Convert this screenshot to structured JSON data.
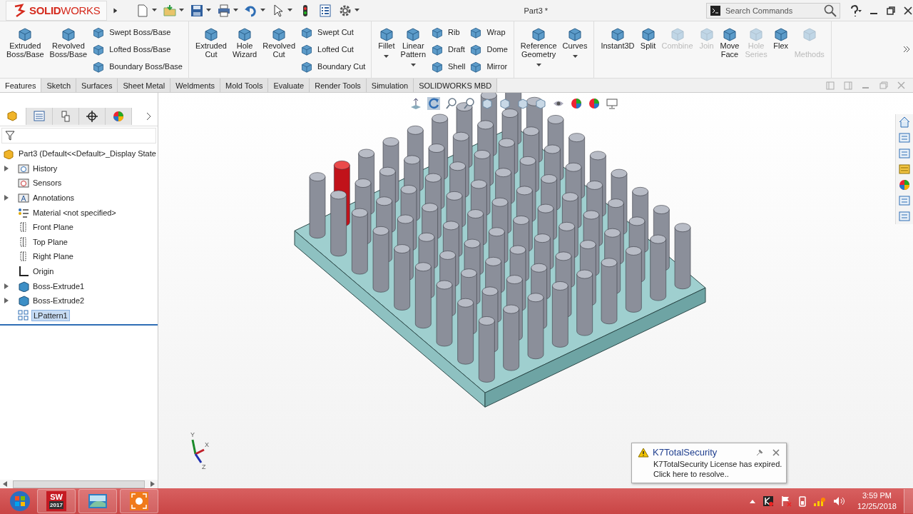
{
  "window": {
    "logo_prefix": "SOLID",
    "logo_suffix": "WORKS",
    "title": "Part3 *"
  },
  "quick_access": [
    {
      "dropdown": true
    },
    {
      "dropdown": true
    },
    {
      "dropdown": true
    },
    {
      "dropdown": true
    },
    {
      "dropdown": true
    },
    {
      "dropdown": true
    },
    {
      "dropdown": false
    },
    {
      "dropdown": false
    },
    {
      "dropdown": true
    }
  ],
  "search": {
    "placeholder": "Search Commands"
  },
  "ribbon": {
    "groups": [
      {
        "items": [
          {
            "kind": "large",
            "label": "Extruded\nBoss/Base",
            "disabled": false,
            "dropdown": false
          },
          {
            "kind": "large",
            "label": "Revolved\nBoss/Base",
            "disabled": false,
            "dropdown": false
          },
          {
            "kind": "stack",
            "items": [
              {
                "label": "Swept Boss/Base"
              },
              {
                "label": "Lofted Boss/Base"
              },
              {
                "label": "Boundary Boss/Base"
              }
            ]
          }
        ]
      },
      {
        "items": [
          {
            "kind": "large",
            "label": "Extruded\nCut",
            "disabled": false,
            "dropdown": false
          },
          {
            "kind": "large",
            "label": "Hole\nWizard",
            "disabled": false,
            "dropdown": false
          },
          {
            "kind": "large",
            "label": "Revolved\nCut",
            "disabled": false,
            "dropdown": false
          },
          {
            "kind": "stack",
            "items": [
              {
                "label": "Swept Cut"
              },
              {
                "label": "Lofted Cut"
              },
              {
                "label": "Boundary Cut"
              }
            ]
          }
        ]
      },
      {
        "items": [
          {
            "kind": "large",
            "label": "Fillet",
            "disabled": false,
            "dropdown": true
          },
          {
            "kind": "large",
            "label": "Linear\nPattern",
            "disabled": false,
            "dropdown": true
          },
          {
            "kind": "stack",
            "items": [
              {
                "label": "Rib"
              },
              {
                "label": "Draft"
              },
              {
                "label": "Shell"
              }
            ]
          },
          {
            "kind": "stack",
            "items": [
              {
                "label": "Wrap"
              },
              {
                "label": "Dome"
              },
              {
                "label": "Mirror"
              }
            ]
          }
        ]
      },
      {
        "items": [
          {
            "kind": "large",
            "label": "Reference\nGeometry",
            "disabled": false,
            "dropdown": true
          },
          {
            "kind": "large",
            "label": "Curves",
            "disabled": false,
            "dropdown": true
          }
        ]
      },
      {
        "items": [
          {
            "kind": "large",
            "label": "Instant3D",
            "disabled": false,
            "dropdown": false
          },
          {
            "kind": "large",
            "label": "Split",
            "disabled": false,
            "dropdown": false
          },
          {
            "kind": "large",
            "label": "Combine",
            "disabled": true,
            "dropdown": false
          },
          {
            "kind": "large",
            "label": "Join",
            "disabled": true,
            "dropdown": false
          },
          {
            "kind": "large",
            "label": "Move\nFace",
            "disabled": false,
            "dropdown": false
          },
          {
            "kind": "large",
            "label": "Hole\nSeries",
            "disabled": true,
            "dropdown": false
          },
          {
            "kind": "large",
            "label": "Flex",
            "disabled": false,
            "dropdown": false
          },
          {
            "kind": "large",
            "label": "\nMethods",
            "disabled": true,
            "dropdown": false
          }
        ]
      }
    ]
  },
  "tabs": [
    {
      "label": "Features",
      "selected": true
    },
    {
      "label": "Sketch",
      "selected": false
    },
    {
      "label": "Surfaces",
      "selected": false
    },
    {
      "label": "Sheet Metal",
      "selected": false
    },
    {
      "label": "Weldments",
      "selected": false
    },
    {
      "label": "Mold Tools",
      "selected": false
    },
    {
      "label": "Evaluate",
      "selected": false
    },
    {
      "label": "Render Tools",
      "selected": false
    },
    {
      "label": "Simulation",
      "selected": false
    },
    {
      "label": "SOLIDWORKS MBD",
      "selected": false
    }
  ],
  "panel_tabs": [
    {
      "selected": true
    },
    {
      "selected": false
    },
    {
      "selected": false
    },
    {
      "selected": false
    },
    {
      "selected": false
    }
  ],
  "tree": {
    "root": "Part3  (Default<<Default>_Display State",
    "items": [
      {
        "kind": "history",
        "label": "History",
        "expandable": true,
        "selected": false
      },
      {
        "kind": "sensors",
        "label": "Sensors",
        "expandable": false,
        "selected": false
      },
      {
        "kind": "annotations",
        "label": "Annotations",
        "expandable": true,
        "selected": false
      },
      {
        "kind": "material",
        "label": "Material <not specified>",
        "expandable": false,
        "selected": false
      },
      {
        "kind": "plane",
        "label": "Front Plane",
        "expandable": false,
        "selected": false
      },
      {
        "kind": "plane",
        "label": "Top Plane",
        "expandable": false,
        "selected": false
      },
      {
        "kind": "plane",
        "label": "Right Plane",
        "expandable": false,
        "selected": false
      },
      {
        "kind": "origin",
        "label": "Origin",
        "expandable": false,
        "selected": false
      },
      {
        "kind": "feature",
        "label": "Boss-Extrude1",
        "expandable": true,
        "selected": false
      },
      {
        "kind": "feature",
        "label": "Boss-Extrude2",
        "expandable": true,
        "selected": false
      },
      {
        "kind": "pattern",
        "label": "LPattern1",
        "expandable": false,
        "selected": true
      }
    ]
  },
  "triad": {
    "axes": [
      "Y",
      "X",
      "Z"
    ]
  },
  "notification": {
    "title": "K7TotalSecurity",
    "message": "K7TotalSecurity License has expired.\nClick here to resolve.."
  },
  "taskbar": {
    "apps": [
      {
        "kind": "solidworks",
        "label": "SW",
        "badge": "2017"
      },
      {
        "kind": "photos"
      },
      {
        "kind": "capture"
      }
    ],
    "time": "3:59 PM",
    "date": "12/25/2018"
  }
}
